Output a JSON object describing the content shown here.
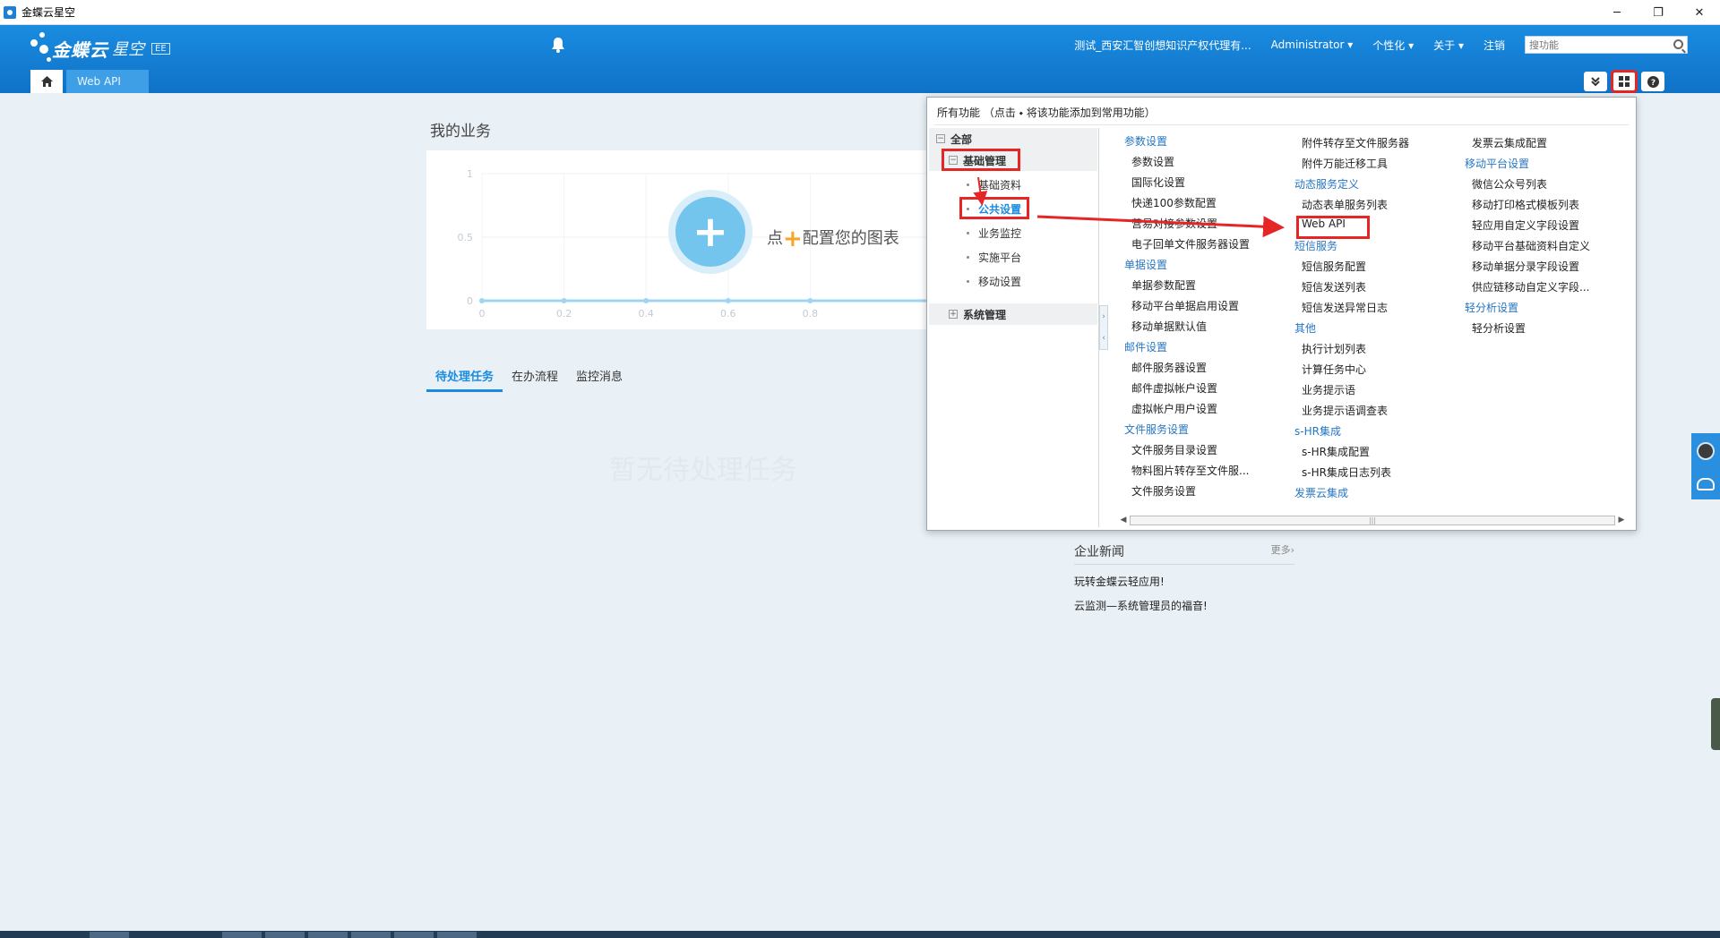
{
  "window": {
    "title": "金蝶云星空",
    "controls": [
      "─",
      "❐",
      "✕"
    ]
  },
  "header": {
    "brand": "金蝶云",
    "brand_sub": "星空",
    "edition": "EE",
    "org": "测试_西安汇智创想知识产权代理有...",
    "user": "Administrator ▾",
    "personalize": "个性化 ▾",
    "about": "关于 ▾",
    "logout": "注销",
    "search_placeholder": "搜功能",
    "tab_active": "Web API"
  },
  "main": {
    "section_title": "我的业务",
    "chart_hint_prefix": "点",
    "chart_hint_suffix": "配置您的图表",
    "chart_plus": "+",
    "tasks": [
      "待处理任务",
      "在办流程",
      "监控消息"
    ],
    "watermark": "暂无待处理任务",
    "news_title": "企业新闻",
    "news_more": "更多›",
    "news_items": [
      "玩转金蝶云轻应用!",
      "云监测—系统管理员的福音!"
    ]
  },
  "chart_data": {
    "type": "line",
    "x": [
      0,
      0.2,
      0.4,
      0.6,
      0.8
    ],
    "y": [
      0,
      0,
      0,
      0,
      0
    ],
    "xticks": [
      "0",
      "0.2",
      "0.4",
      "0.6",
      "0.8"
    ],
    "yticks": [
      "0",
      "0.5",
      "1"
    ],
    "ylim": [
      0,
      1
    ],
    "grid": true,
    "line_color": "#9fd5f3"
  },
  "popup": {
    "title": "所有功能  （点击 ⬩ 将该功能添加到常用功能）",
    "tree": {
      "root": "全部",
      "group1": "基础管理",
      "children": [
        "基础资料",
        "公共设置",
        "业务监控",
        "实施平台",
        "移动设置"
      ],
      "group2": "系统管理"
    },
    "col1": [
      {
        "t": "参数设置",
        "cat": true
      },
      {
        "t": "参数设置"
      },
      {
        "t": "国际化设置"
      },
      {
        "t": "快递100参数配置"
      },
      {
        "t": "营易对接参数设置"
      },
      {
        "t": "电子回单文件服务器设置"
      },
      {
        "t": "单据设置",
        "cat": true
      },
      {
        "t": "单据参数配置"
      },
      {
        "t": "移动平台单据启用设置"
      },
      {
        "t": "移动单据默认值"
      },
      {
        "t": "邮件设置",
        "cat": true
      },
      {
        "t": "邮件服务器设置"
      },
      {
        "t": "邮件虚拟帐户设置"
      },
      {
        "t": "虚拟帐户用户设置"
      },
      {
        "t": "文件服务设置",
        "cat": true
      },
      {
        "t": "文件服务目录设置"
      },
      {
        "t": "物料图片转存至文件服..."
      },
      {
        "t": "文件服务设置"
      }
    ],
    "col2": [
      {
        "t": "附件转存至文件服务器"
      },
      {
        "t": "附件万能迁移工具"
      },
      {
        "t": "动态服务定义",
        "cat": true
      },
      {
        "t": "动态表单服务列表"
      },
      {
        "t": "Web API"
      },
      {
        "t": "短信服务",
        "cat": true
      },
      {
        "t": "短信服务配置"
      },
      {
        "t": "短信发送列表"
      },
      {
        "t": "短信发送异常日志"
      },
      {
        "t": "其他",
        "cat": true
      },
      {
        "t": "执行计划列表"
      },
      {
        "t": "计算任务中心"
      },
      {
        "t": "业务提示语"
      },
      {
        "t": "业务提示语调查表"
      },
      {
        "t": "s-HR集成",
        "cat": true
      },
      {
        "t": "s-HR集成配置"
      },
      {
        "t": "s-HR集成日志列表"
      },
      {
        "t": "发票云集成",
        "cat": true
      }
    ],
    "col3": [
      {
        "t": "发票云集成配置"
      },
      {
        "t": "移动平台设置",
        "cat": true
      },
      {
        "t": "微信公众号列表"
      },
      {
        "t": "移动打印格式模板列表"
      },
      {
        "t": "轻应用自定义字段设置"
      },
      {
        "t": "移动平台基础资料自定义"
      },
      {
        "t": "移动单据分录字段设置"
      },
      {
        "t": "供应链移动自定义字段..."
      },
      {
        "t": "轻分析设置",
        "cat": true
      },
      {
        "t": "轻分析设置"
      }
    ],
    "scroll_grip": "|||"
  },
  "colors": {
    "accent": "#1a8ce0",
    "highlight": "#e62525",
    "category": "#2676c3"
  }
}
